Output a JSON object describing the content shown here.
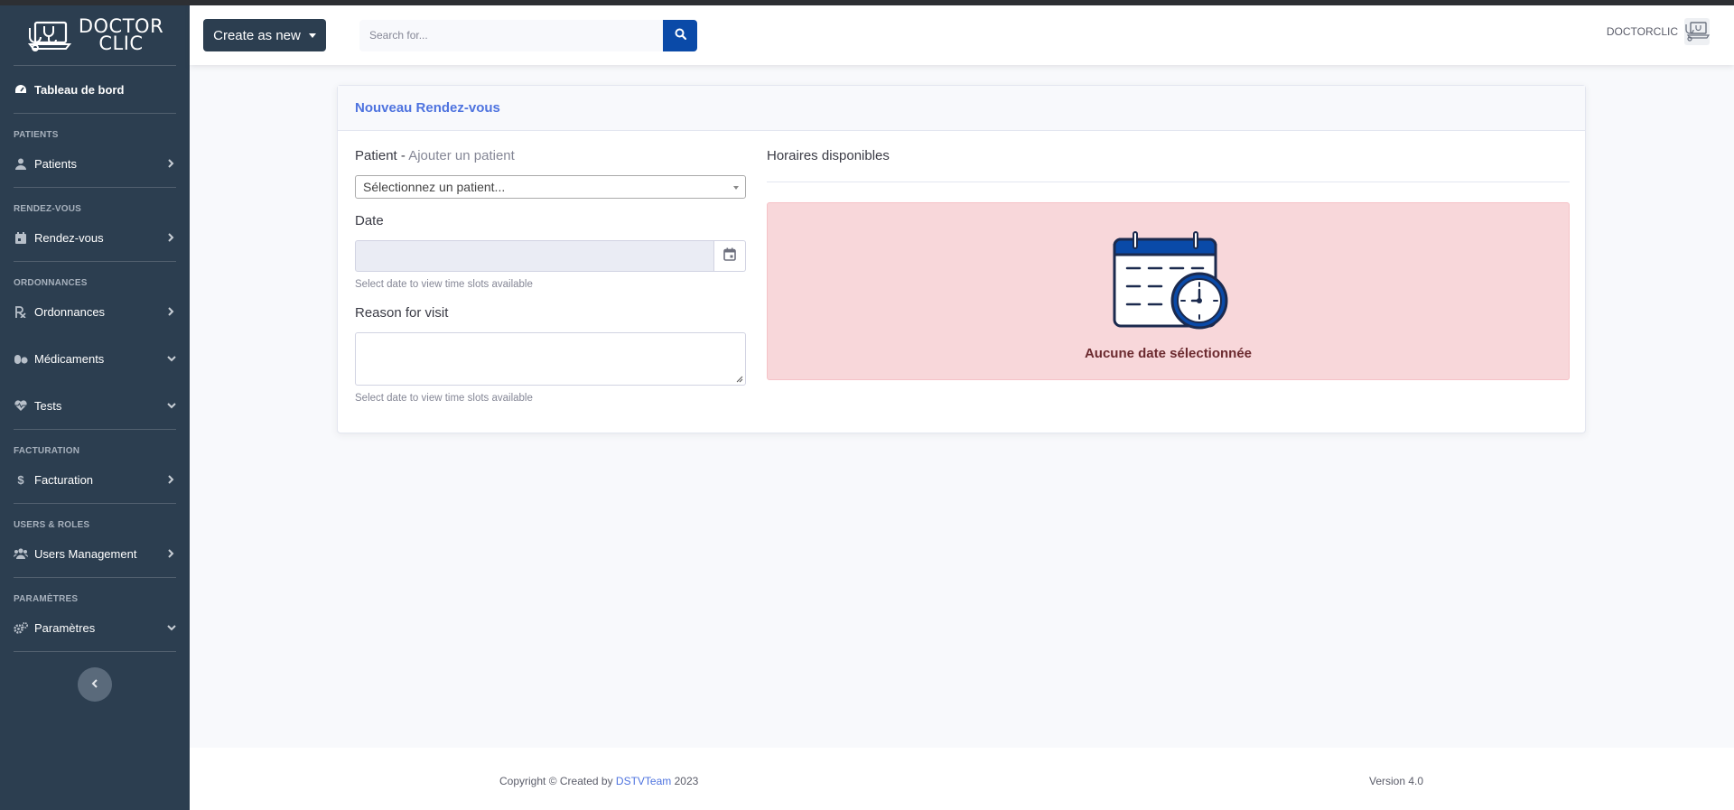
{
  "brand": {
    "line1": "DOCTOR",
    "line2": "CLIC"
  },
  "sidebar": {
    "dashboard": "Tableau de bord",
    "headings": {
      "patients": "PATIENTS",
      "appointments": "RENDEZ-VOUS",
      "prescriptions": "ORDONNANCES",
      "billing": "FACTURATION",
      "users": "USERS & ROLES",
      "settings": "PARAMÈTRES"
    },
    "items": {
      "patients": "Patients",
      "appointments": "Rendez-vous",
      "prescriptions": "Ordonnances",
      "medications": "Médicaments",
      "tests": "Tests",
      "billing": "Facturation",
      "users": "Users Management",
      "settings": "Paramètres"
    }
  },
  "topbar": {
    "create_label": "Create as new",
    "search_placeholder": "Search for...",
    "user_name": "DOCTORCLIC"
  },
  "card": {
    "title": "Nouveau Rendez-vous",
    "patient_label": "Patient",
    "patient_separator": " - ",
    "add_patient": "Ajouter un patient",
    "patient_select": "Sélectionnez un patient...",
    "date_label": "Date",
    "date_help": "Select date to view time slots available",
    "reason_label": "Reason for visit",
    "reason_help": "Select date to view time slots available",
    "slots_title": "Horaires disponibles",
    "no_date": "Aucune date sélectionnée"
  },
  "footer": {
    "copyright_prefix": "Copyright © Created by ",
    "team": "DSTVTeam",
    "year": " 2023",
    "version": "Version 4.0"
  },
  "colors": {
    "sidebar": "#2c3e50",
    "accent": "#4e73df",
    "search_button": "#0a4aa8",
    "alert_bg": "#f8d7da"
  }
}
